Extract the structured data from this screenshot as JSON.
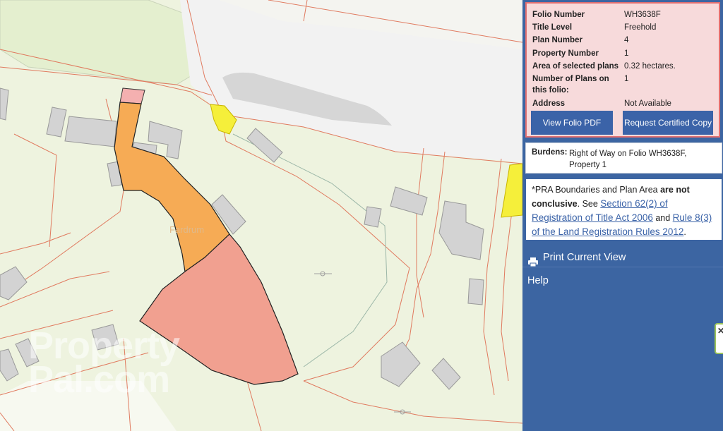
{
  "map": {
    "place_label": "Fardrum",
    "watermark_line1": "Property",
    "watermark_line2": "Pal.com"
  },
  "folio": {
    "rows": [
      {
        "label": "Folio Number",
        "value": "WH3638F"
      },
      {
        "label": "Title Level",
        "value": "Freehold"
      },
      {
        "label": "Plan Number",
        "value": "4"
      },
      {
        "label": "Property Number",
        "value": "1"
      },
      {
        "label": "Area of selected plans",
        "value": "0.32 hectares."
      },
      {
        "label": "Number of Plans on this folio:",
        "value": "1"
      },
      {
        "label": "Address",
        "value": "Not Available"
      }
    ],
    "view_pdf_label": "View Folio PDF",
    "request_copy_label": "Request Certified Copy"
  },
  "burdens": {
    "label": "Burdens:",
    "value": "Right of Way on Folio WH3638F, Property 1"
  },
  "note": {
    "prefix": "*PRA Boundaries and Plan Area ",
    "bold": "are not conclusive",
    "see": ". See ",
    "link1": "Section 62(2) of Registration of Title Act 2006",
    "and": " and ",
    "link2": "Rule 8(3) of the Land Registration Rules 2012",
    "end": "."
  },
  "menu": {
    "print_label": "Print Current View",
    "help_label": "Help"
  },
  "colors": {
    "panel_blue": "#3c65a2",
    "button_blue": "#3b63a8",
    "folio_bg": "#f7dadb",
    "folio_border": "#e06f71",
    "selected_orange": "#f6ab55",
    "selected_pink": "#f1a090",
    "right_of_way_yellow": "#f5ef3a",
    "land_green": "#eef3df"
  },
  "icons": [
    "printer-icon"
  ]
}
